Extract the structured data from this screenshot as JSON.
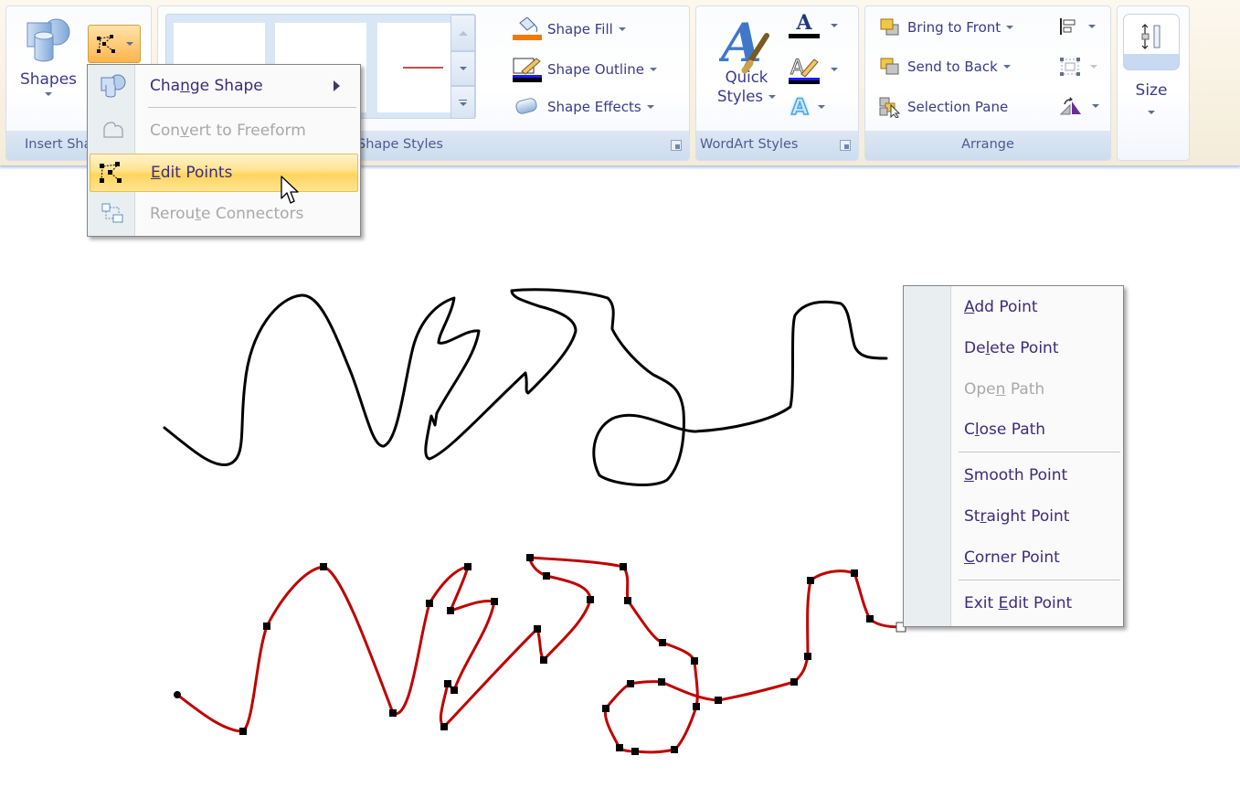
{
  "ribbon": {
    "insert_shapes": {
      "group_label": "Insert Shapes",
      "shapes_label": "Shapes",
      "edit_shape_button": "edit-shape-icon"
    },
    "shape_styles": {
      "group_label": "Shape Styles",
      "shape_fill": "Shape Fill",
      "shape_outline": "Shape Outline",
      "shape_effects": "Shape Effects",
      "fill_color": "#f07a00",
      "outline_color": "#1a1aff",
      "preview_line_color": "#c0504d"
    },
    "wordart_styles": {
      "group_label": "WordArt Styles",
      "quick_styles_line1": "Quick",
      "quick_styles_line2": "Styles",
      "text_fill_letter": "A",
      "text_effects_letter": "A"
    },
    "arrange": {
      "group_label": "Arrange",
      "bring_to_front": "Bring to Front",
      "send_to_back": "Send to Back",
      "selection_pane": "Selection Pane"
    },
    "size": {
      "label": "Size"
    }
  },
  "edit_shape_menu": {
    "items": [
      {
        "label_pre": "Cha",
        "label_acc": "n",
        "label_post": "ge Shape",
        "disabled": false,
        "submenu": true
      },
      {
        "label_pre": "Con",
        "label_acc": "v",
        "label_post": "ert to Freeform",
        "disabled": true
      },
      {
        "label_pre": "",
        "label_acc": "E",
        "label_post": "dit Points",
        "disabled": false,
        "highlighted": true
      },
      {
        "label_pre": "Rerou",
        "label_acc": "t",
        "label_post": "e Connectors",
        "disabled": true
      }
    ]
  },
  "context_menu": {
    "items": [
      {
        "label_pre": "",
        "label_acc": "A",
        "label_post": "dd Point",
        "disabled": false
      },
      {
        "label_pre": "De",
        "label_acc": "l",
        "label_post": "ete Point",
        "disabled": false
      },
      {
        "label_pre": "Ope",
        "label_acc": "n",
        "label_post": " Path",
        "disabled": true
      },
      {
        "label_pre": "C",
        "label_acc": "l",
        "label_post": "ose Path",
        "disabled": false
      },
      {
        "label_pre": "",
        "label_acc": "S",
        "label_post": "mooth Point",
        "disabled": false
      },
      {
        "label_pre": "St",
        "label_acc": "r",
        "label_post": "aight Point",
        "disabled": false
      },
      {
        "label_pre": "",
        "label_acc": "C",
        "label_post": "orner Point",
        "disabled": false
      },
      {
        "label_pre": "Exit ",
        "label_acc": "E",
        "label_post": "dit Point",
        "disabled": false
      }
    ]
  },
  "canvas": {
    "freeform_color": "#000000",
    "edit_outline_color": "#c00000",
    "edit_vertex_color": "#000000"
  }
}
